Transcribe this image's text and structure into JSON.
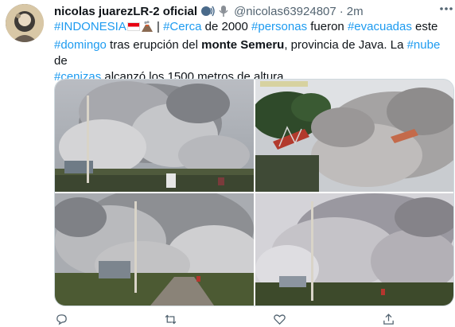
{
  "author": {
    "display_name": "nicolas juarezLR-2 oficial",
    "handle": "@nicolas63924807",
    "time": "2m",
    "separator": "·"
  },
  "tweet": {
    "line1": {
      "tag_indonesia": "#INDONESIA",
      "pipe": " | ",
      "tag_cerca": "#Cerca",
      "t1": " de 2000 ",
      "tag_personas": "#personas",
      "t2": " fueron ",
      "tag_evacuadas": "#evacuadas",
      "t3": " este"
    },
    "line2": {
      "tag_domingo": "#domingo",
      "t1": " tras erupción del ",
      "bold_place": "monte Semeru",
      "t2": ", provincia de Java. La ",
      "tag_nube": "#nube",
      "t3": " de"
    },
    "line3": {
      "tag_cenizas": "#cenizas",
      "t1": " alcanzó los 1500 metros de altura."
    }
  },
  "media": {
    "photos": [
      {
        "name": "ash-cloud-village"
      },
      {
        "name": "ash-cloud-bridge"
      },
      {
        "name": "ash-cloud-road"
      },
      {
        "name": "ash-cloud-houses"
      }
    ]
  },
  "actions": [
    "reply-icon",
    "retweet-icon",
    "like-icon",
    "share-icon"
  ],
  "colors": {
    "link": "#1d9bf0",
    "text": "#0f1419",
    "muted": "#536471"
  }
}
